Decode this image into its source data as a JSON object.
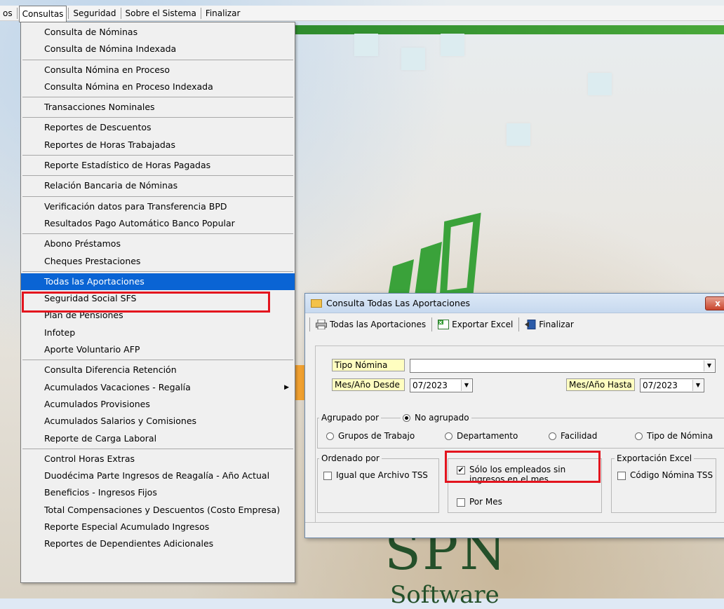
{
  "menubar": {
    "items": [
      "os",
      "Consultas",
      "Seguridad",
      "Sobre el Sistema",
      "Finalizar"
    ]
  },
  "consultas_menu": {
    "groups": [
      [
        "Consulta de Nóminas",
        "Consulta de Nómina Indexada"
      ],
      [
        "Consulta Nómina en Proceso",
        "Consulta Nómina en Proceso Indexada"
      ],
      [
        "Transacciones Nominales"
      ],
      [
        "Reportes de Descuentos",
        "Reportes de Horas Trabajadas"
      ],
      [
        "Reporte Estadístico de Horas Pagadas"
      ],
      [
        "Relación Bancaria de Nóminas"
      ],
      [
        "Verificación datos para Transferencia BPD",
        "Resultados Pago Automático Banco Popular"
      ],
      [
        "Abono Préstamos",
        "Cheques Prestaciones"
      ],
      [
        "Todas las Aportaciones",
        "Seguridad Social SFS",
        "Plan de Pensiones",
        "Infotep",
        "Aporte Voluntario AFP"
      ],
      [
        "Consulta Diferencia Retención",
        "Acumulados Vacaciones - Regalía",
        "Acumulados Provisiones",
        "Acumulados Salarios y Comisiones",
        "Reporte de Carga Laboral"
      ],
      [
        "Control Horas Extras",
        "Duodécima Parte Ingresos de Reagalía - Año Actual",
        "Beneficios - Ingresos Fijos",
        "Total Compensaciones y Descuentos (Costo Empresa)",
        "Reporte Especial Acumulado Ingresos",
        "Reportes de Dependientes Adicionales"
      ]
    ],
    "highlighted": "Todas las Aportaciones",
    "submenu_item": "Acumulados Vacaciones - Regalía"
  },
  "background": {
    "brand": "SPN",
    "brand_sub": "Software"
  },
  "dialog": {
    "title": "Consulta Todas Las Aportaciones",
    "close_label": "x",
    "toolbar": {
      "print_label": "Todas las Aportaciones",
      "excel_label": "Exportar Excel",
      "exit_label": "Finalizar"
    },
    "tipo_nomina": {
      "label": "Tipo Nómina",
      "value": ""
    },
    "mes_desde": {
      "label": "Mes/Año Desde",
      "value": "07/2023"
    },
    "mes_hasta": {
      "label": "Mes/Año Hasta",
      "value": "07/2023"
    },
    "agrupado": {
      "legend": "Agrupado por",
      "options": [
        "No agrupado",
        "Grupos de Trabajo",
        "Departamento",
        "Facilidad",
        "Tipo de Nómina"
      ],
      "selected": "No agrupado"
    },
    "ordenado": {
      "legend": "Ordenado por",
      "igual_tss": "Igual que Archivo TSS",
      "igual_tss_checked": false
    },
    "filtros": {
      "solo_sin_ingresos": "Sólo los empleados sin ingresos en el mes",
      "solo_sin_ingresos_checked": true,
      "por_mes": "Por Mes",
      "por_mes_checked": false
    },
    "exportacion": {
      "legend": "Exportación Excel",
      "codigo_tss": "Código Nómina TSS",
      "codigo_tss_checked": false
    }
  },
  "colors": {
    "highlight": "#0a64d4",
    "annotation_red": "#e3141e",
    "label_yellow": "#fffec0",
    "green_band": "#2e8b2e"
  }
}
